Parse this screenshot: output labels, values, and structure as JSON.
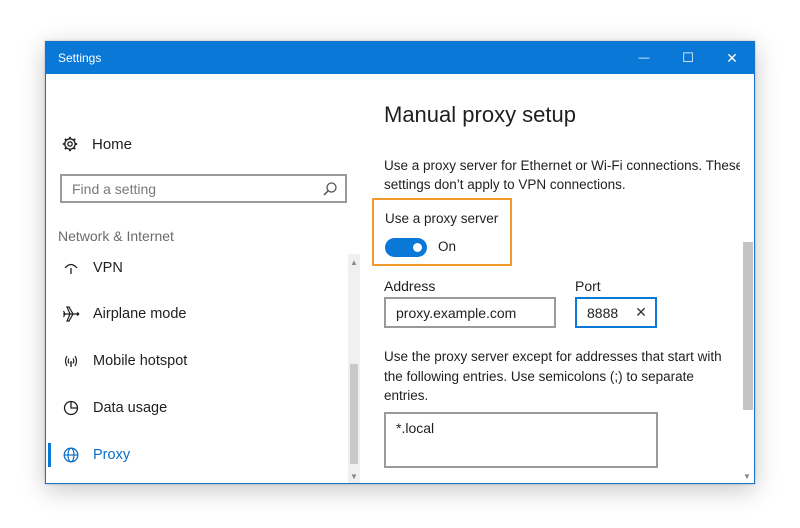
{
  "window": {
    "title": "Settings",
    "controls": {
      "minimize": "—",
      "maximize": "☐",
      "close": "✕"
    }
  },
  "sidebar": {
    "home_label": "Home",
    "home_icon": "gear-icon",
    "search": {
      "placeholder": "Find a setting",
      "value": "",
      "icon": "search-icon"
    },
    "section_label": "Network & Internet",
    "items": [
      {
        "label": "VPN",
        "icon": "vpn-icon",
        "selected": false
      },
      {
        "label": "Airplane mode",
        "icon": "airplane-icon",
        "selected": false
      },
      {
        "label": "Mobile hotspot",
        "icon": "hotspot-icon",
        "selected": false
      },
      {
        "label": "Data usage",
        "icon": "data-usage-icon",
        "selected": false
      },
      {
        "label": "Proxy",
        "icon": "globe-icon",
        "selected": true
      }
    ]
  },
  "main": {
    "title": "Manual proxy setup",
    "description": "Use a proxy server for Ethernet or Wi-Fi connections. These settings don’t apply to VPN connections.",
    "use_proxy": {
      "label": "Use a proxy server",
      "state_label": "On",
      "on": true
    },
    "address": {
      "label": "Address",
      "value": "proxy.example.com"
    },
    "port": {
      "label": "Port",
      "value": "8888"
    },
    "exceptions_description": "Use the proxy server except for addresses that start with the following entries. Use semicolons (;) to separate entries.",
    "exceptions_value": "*.local"
  },
  "colors": {
    "accent": "#0a78d7",
    "highlight_border": "#f29a2e"
  }
}
